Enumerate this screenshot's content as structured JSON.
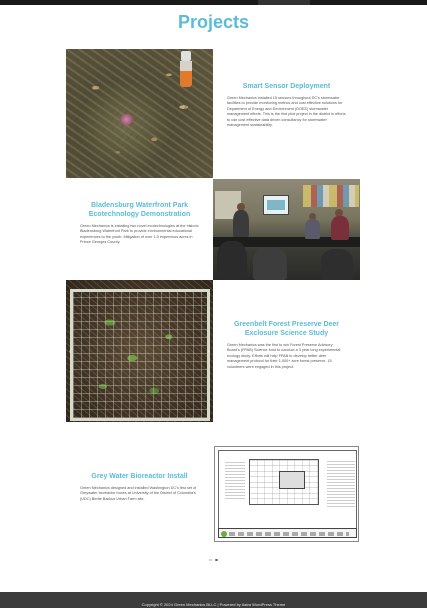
{
  "page": {
    "title": "Projects"
  },
  "projects": [
    {
      "title": "Smart Sensor Deployment",
      "description": "Green Mechanics installed 15 sensors throughout DC's stormwater facilities to provide monitoring metrics and cost effective solutions for Department of Energy and Environment (DOEE) stormwater management efforts. This is the first pilot project in the district in efforts to use cost effective data driven consultancy for stormwater management sustainability.",
      "image": "sensor-in-soil-photo"
    },
    {
      "title": "Bladensburg Waterfront Park Ecotechnology Demonstration",
      "description": "Green Mechanics is installing two novel ecotechnologies at the historic Bladensburg Waterfront Park to provide environmental educational experiences to the youth. Mitigation of over 1.5 impervious acres in Prince Georges County.",
      "image": "classroom-photo"
    },
    {
      "title": "Greenbelt Forest Preserve Deer Exclosure Science Study",
      "description": "Green Mechanics was the first to win Forest Preserve Advisory Board's (FPAB) Science fund to conduct a 3 year long experimental ecology study. Efforts will help FPAB to develop better deer management protocol for their 1,000+ acre forest preserve. 15 volunteers were engaged in this project.",
      "image": "vegetation-plot-photo"
    },
    {
      "title": "Grey Water Bioreactor Install",
      "description": "Green Mechanics designed and installed Washington DC's first set of Greywater bioreactor boxes at University of the District of Columbia's (UDC) Bertie Backus Urban Farm site.",
      "image": "site-plan-drawing"
    }
  ],
  "carousel": {
    "prev_icon": "‹",
    "next_icon": "›",
    "dots": 2,
    "active_dot": 2
  },
  "footer": {
    "text": "Copyright © 2024 Green Mechanics BLLC | Powered by Astra WordPress Theme"
  },
  "colors": {
    "title_blue": "#5bbcd6",
    "footer_bg": "#3c3c3c"
  }
}
